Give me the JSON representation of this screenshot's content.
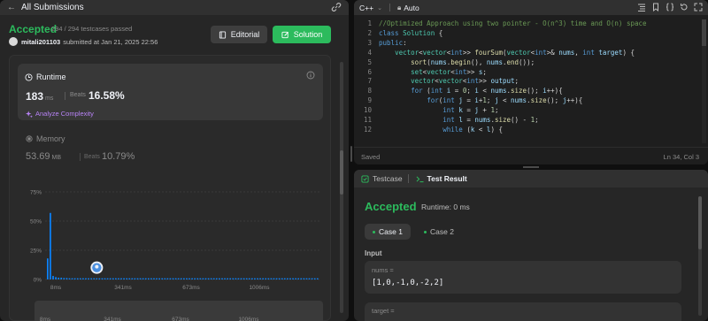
{
  "submission": {
    "back_label": "All Submissions",
    "status": "Accepted",
    "passed": "294 / 294 testcases passed",
    "author": "mitali201103",
    "submitted": "submitted at Jan 21, 2025 22:56",
    "editorial_label": "Editorial",
    "solution_label": "Solution"
  },
  "runtime": {
    "title": "Runtime",
    "value": "183",
    "unit": "ms",
    "beats_label": "Beats",
    "beats_value": "16.58%",
    "analyze_label": "Analyze Complexity"
  },
  "memory": {
    "title": "Memory",
    "value": "53.69",
    "unit": "MB",
    "beats_label": "Beats",
    "beats_value": "10.79%"
  },
  "chart_data": {
    "type": "bar",
    "y_ticks": [
      "75%",
      "50%",
      "25%",
      "0%"
    ],
    "ylim": [
      0,
      75
    ],
    "x_ticks": [
      "8ms",
      "341ms",
      "673ms",
      "1006ms"
    ],
    "minimap_ticks": [
      "8ms",
      "341ms",
      "673ms",
      "1006ms"
    ],
    "values": [
      18,
      57,
      3,
      2,
      1.5,
      1.5,
      1.2,
      1.2,
      1,
      1,
      1,
      1,
      1,
      1,
      1,
      1,
      1,
      1,
      1,
      1,
      1,
      1,
      1,
      1,
      1,
      1,
      1,
      1,
      1,
      1,
      1,
      1,
      1,
      1,
      1,
      1,
      1,
      1,
      1,
      1,
      1,
      1,
      1,
      1,
      1,
      1,
      1,
      1,
      1,
      1,
      1,
      1,
      1,
      1,
      1,
      1,
      1,
      1,
      1,
      1,
      1,
      1,
      1,
      1,
      1,
      1,
      1,
      1,
      1,
      1,
      1,
      1,
      1,
      1,
      1,
      1,
      1,
      1,
      1,
      1,
      1,
      1,
      1,
      1,
      1,
      1,
      1,
      1,
      1,
      1,
      1,
      1,
      1,
      1,
      1,
      1,
      1,
      1,
      1,
      1
    ],
    "highlight_index": 18,
    "bar_color": "#0a84ff"
  },
  "editor": {
    "language": "C++",
    "mode": "Auto",
    "status": "Saved",
    "cursor": "Ln 34, Col 3"
  },
  "code_lines": [
    {
      "n": "1",
      "html": "<span class=\"cm\">//Optimized Approach using two pointer - O(n^3) time and O(n) space</span>"
    },
    {
      "n": "2",
      "html": "<span class=\"kw\">class</span> <span class=\"ty\">Solution</span> {"
    },
    {
      "n": "3",
      "html": "<span class=\"kw\">public</span>:"
    },
    {
      "n": "4",
      "html": "    <span class=\"ty\">vector</span>&lt;<span class=\"ty\">vector</span>&lt;<span class=\"kw\">int</span>&gt;&gt; <span class=\"fn\">fourSum</span>(<span class=\"ty\">vector</span>&lt;<span class=\"kw\">int</span>&gt;&amp; <span class=\"vr\">nums</span>, <span class=\"kw\">int</span> <span class=\"vr\">target</span>) {"
    },
    {
      "n": "5",
      "html": "        <span class=\"fn\">sort</span>(<span class=\"vr\">nums</span>.<span class=\"fn\">begin</span>(), <span class=\"vr\">nums</span>.<span class=\"fn\">end</span>());"
    },
    {
      "n": "6",
      "html": "        <span class=\"ty\">set</span>&lt;<span class=\"ty\">vector</span>&lt;<span class=\"kw\">int</span>&gt;&gt; <span class=\"vr\">s</span>;"
    },
    {
      "n": "7",
      "html": "        <span class=\"ty\">vector</span>&lt;<span class=\"ty\">vector</span>&lt;<span class=\"kw\">int</span>&gt;&gt; <span class=\"vr\">output</span>;"
    },
    {
      "n": "8",
      "html": "        <span class=\"kw\">for</span> (<span class=\"kw\">int</span> <span class=\"vr\">i</span> = <span class=\"nm\">0</span>; <span class=\"vr\">i</span> &lt; <span class=\"vr\">nums</span>.<span class=\"fn\">size</span>(); <span class=\"vr\">i</span>++){"
    },
    {
      "n": "9",
      "html": "            <span class=\"kw\">for</span>(<span class=\"kw\">int</span> <span class=\"vr\">j</span> = <span class=\"vr\">i</span>+<span class=\"nm\">1</span>; <span class=\"vr\">j</span> &lt; <span class=\"vr\">nums</span>.<span class=\"fn\">size</span>(); <span class=\"vr\">j</span>++){"
    },
    {
      "n": "10",
      "html": "                <span class=\"kw\">int</span> <span class=\"vr\">k</span> = <span class=\"vr\">j</span> + <span class=\"nm\">1</span>;"
    },
    {
      "n": "11",
      "html": "                <span class=\"kw\">int</span> <span class=\"vr\">l</span> = <span class=\"vr\">nums</span>.<span class=\"fn\">size</span>() - <span class=\"nm\">1</span>;"
    },
    {
      "n": "12",
      "html": "                <span class=\"kw\">while</span> (<span class=\"vr\">k</span> &lt; <span class=\"vr\">l</span>) {"
    }
  ],
  "result": {
    "tab_testcase": "Testcase",
    "tab_result": "Test Result",
    "status": "Accepted",
    "runtime": "Runtime: 0 ms",
    "case1": "Case 1",
    "case2": "Case 2",
    "input_label": "Input",
    "var1_name": "nums =",
    "var1_value": "[1,0,-1,0,-2,2]",
    "var2_name": "target ="
  },
  "colors": {
    "accent_green": "#2cbb5d",
    "bar_blue": "#0a84ff",
    "purple": "#b883f6"
  }
}
